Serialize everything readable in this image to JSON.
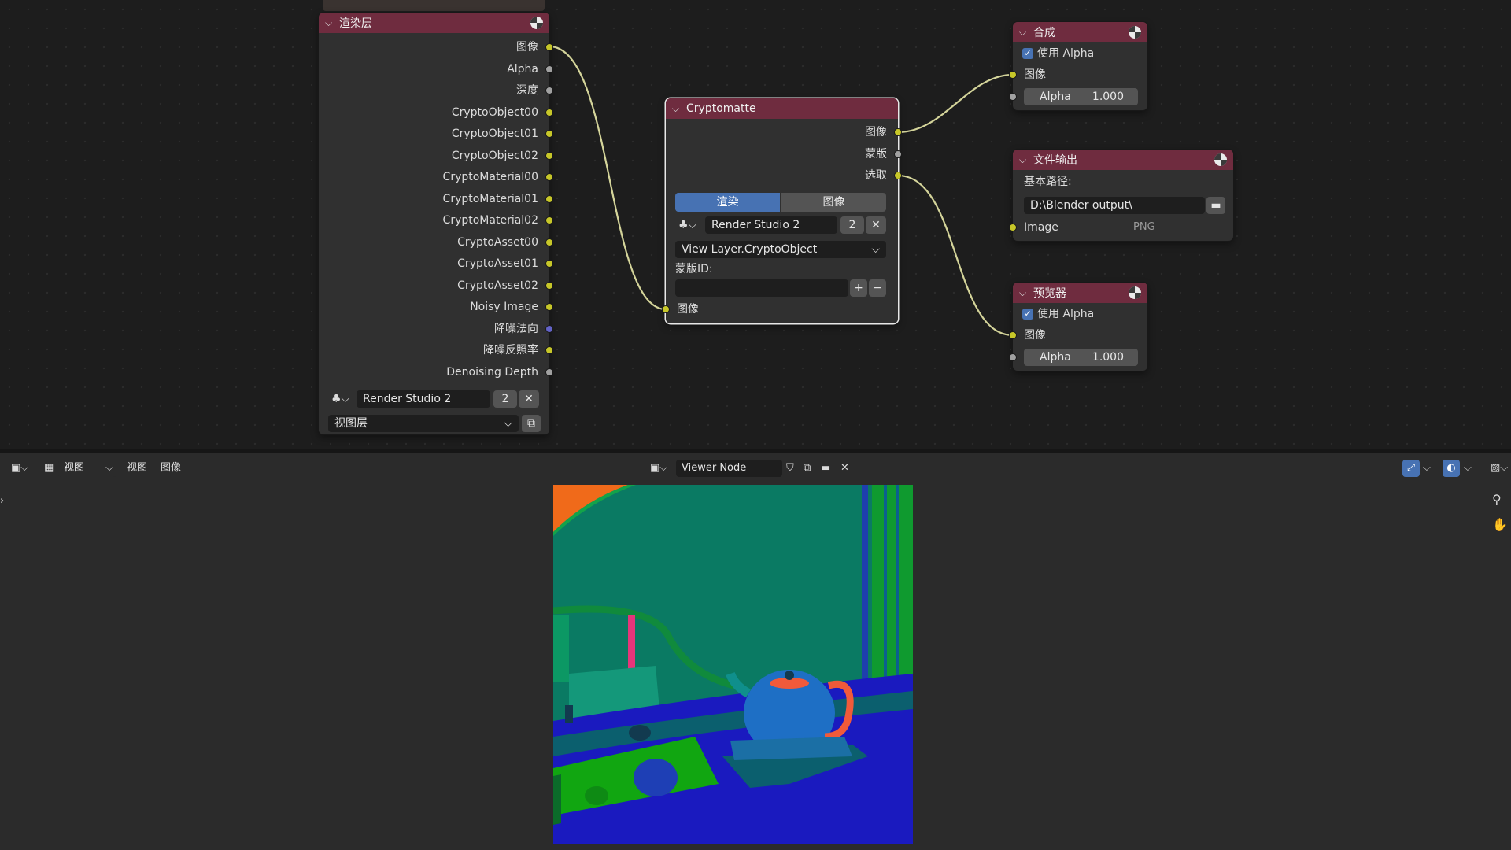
{
  "render_layers_node": {
    "title": "渲染层",
    "outputs": [
      "图像",
      "Alpha",
      "深度",
      "CryptoObject00",
      "CryptoObject01",
      "CryptoObject02",
      "CryptoMaterial00",
      "CryptoMaterial01",
      "CryptoMaterial02",
      "CryptoAsset00",
      "CryptoAsset01",
      "CryptoAsset02",
      "Noisy Image",
      "降噪法向",
      "降噪反照率",
      "Denoising Depth"
    ],
    "scene_name": "Render Studio 2",
    "user_count": "2",
    "view_layer": "视图层"
  },
  "cryptomatte_node": {
    "title": "Cryptomatte",
    "outputs": [
      "图像",
      "蒙版",
      "选取"
    ],
    "tabs": [
      "渲染",
      "图像"
    ],
    "scene_name": "Render Studio 2",
    "user_count": "2",
    "layer_name": "View Layer.CryptoObject",
    "matte_id_label": "蒙版ID:",
    "input_label": "图像"
  },
  "composite_node": {
    "title": "合成",
    "use_alpha_label": "使用 Alpha",
    "image_label": "图像",
    "alpha_label": "Alpha",
    "alpha_value": "1.000"
  },
  "file_output_node": {
    "title": "文件输出",
    "base_path_label": "基本路径:",
    "base_path": "D:\\Blender output\\",
    "input_label": "Image",
    "format": "PNG"
  },
  "viewer_node": {
    "title": "预览器",
    "use_alpha_label": "使用 Alpha",
    "image_label": "图像",
    "alpha_label": "Alpha",
    "alpha_value": "1.000"
  },
  "image_editor": {
    "view_mode": "视图",
    "menu_view": "视图",
    "menu_image": "图像",
    "image_name": "Viewer Node"
  },
  "colors": {
    "node_header": "#6f2c3f",
    "socket_color": "#c7c729",
    "socket_grey": "#a1a1a1",
    "socket_vector": "#6363c7",
    "accent": "#4772b3"
  },
  "icons": [
    "globe-icon",
    "chevron-down-icon",
    "scene-icon",
    "close-icon",
    "folder-icon",
    "plus-icon",
    "minus-icon",
    "zoom-icon",
    "hand-icon",
    "gizmo-icon",
    "overlay-icon"
  ]
}
